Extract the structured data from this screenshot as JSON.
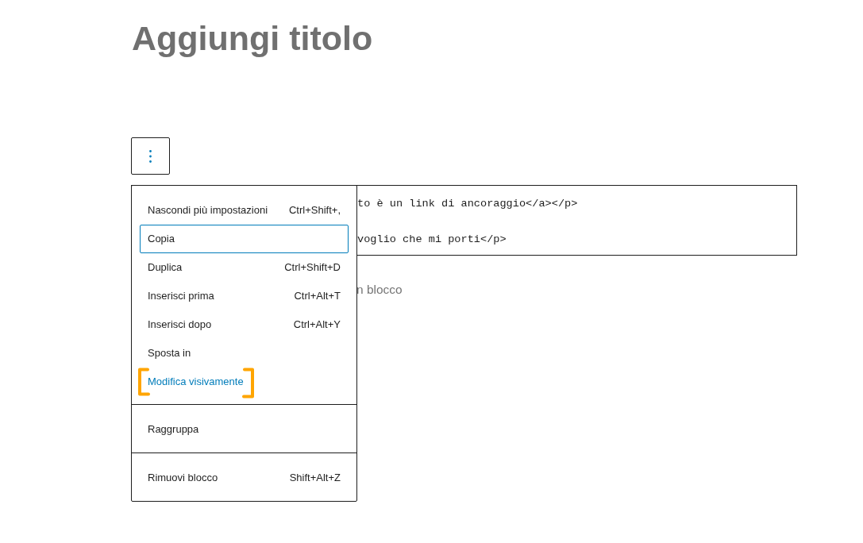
{
  "title_field": {
    "placeholder": "Aggiungi titolo"
  },
  "block_toolbar": {
    "options_button": {
      "expanded": true
    }
  },
  "code_editor": {
    "lines": [
      "to è un link di ancoraggio</a></p>",
      "voglio che mi porti</p>"
    ]
  },
  "block_appender": {
    "placeholder": "n blocco"
  },
  "options_menu": {
    "groups": [
      {
        "items": [
          {
            "label": "Nascondi più impostazioni",
            "shortcut": "Ctrl+Shift+,",
            "focused": false,
            "highlighted": false,
            "annotated": false
          },
          {
            "label": "Copia",
            "focused": true,
            "highlighted": false,
            "annotated": false
          },
          {
            "label": "Duplica",
            "shortcut": "Ctrl+Shift+D",
            "focused": false,
            "highlighted": false,
            "annotated": false
          },
          {
            "label": "Inserisci prima",
            "shortcut": "Ctrl+Alt+T",
            "focused": false,
            "highlighted": false,
            "annotated": false
          },
          {
            "label": "Inserisci dopo",
            "shortcut": "Ctrl+Alt+Y",
            "focused": false,
            "highlighted": false,
            "annotated": false
          },
          {
            "label": "Sposta in",
            "focused": false,
            "highlighted": false,
            "annotated": false
          },
          {
            "label": "Modifica visivamente",
            "focused": false,
            "highlighted": true,
            "annotated": true
          }
        ]
      },
      {
        "items": [
          {
            "label": "Raggruppa",
            "focused": false,
            "highlighted": false,
            "annotated": false
          }
        ]
      },
      {
        "items": [
          {
            "label": "Rimuovi blocco",
            "shortcut": "Shift+Alt+Z",
            "focused": false,
            "highlighted": false,
            "annotated": false
          }
        ]
      }
    ]
  }
}
